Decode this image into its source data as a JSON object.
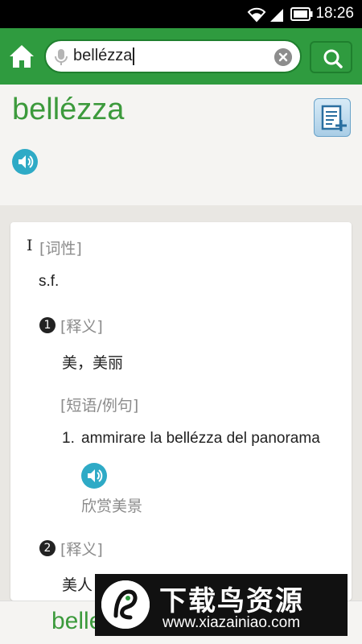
{
  "status_bar": {
    "time": "18:26"
  },
  "search": {
    "query": "bellézza"
  },
  "entry": {
    "headword": "bellézza",
    "pos_marker": "I",
    "pos_label": "[词性]",
    "pos_value": "s.f.",
    "senses": [
      {
        "number": "1",
        "label": "[释义]",
        "definition": "美，美丽"
      },
      {
        "number": "2",
        "label": "[释义]",
        "definition": "美人"
      }
    ],
    "phrases_label": "[短语/例句]",
    "example": {
      "index": "1.",
      "text": "ammirare la bellézza del panorama",
      "translation": "欣赏美景"
    }
  },
  "bottom_bar": {
    "word": "belle"
  },
  "watermark": {
    "title": "下载鸟资源",
    "url": "www.xiazainiao.com"
  },
  "colors": {
    "brand_green": "#2f9b3f",
    "headword_green": "#3c9a3c",
    "speaker_blue": "#2eaac6"
  }
}
